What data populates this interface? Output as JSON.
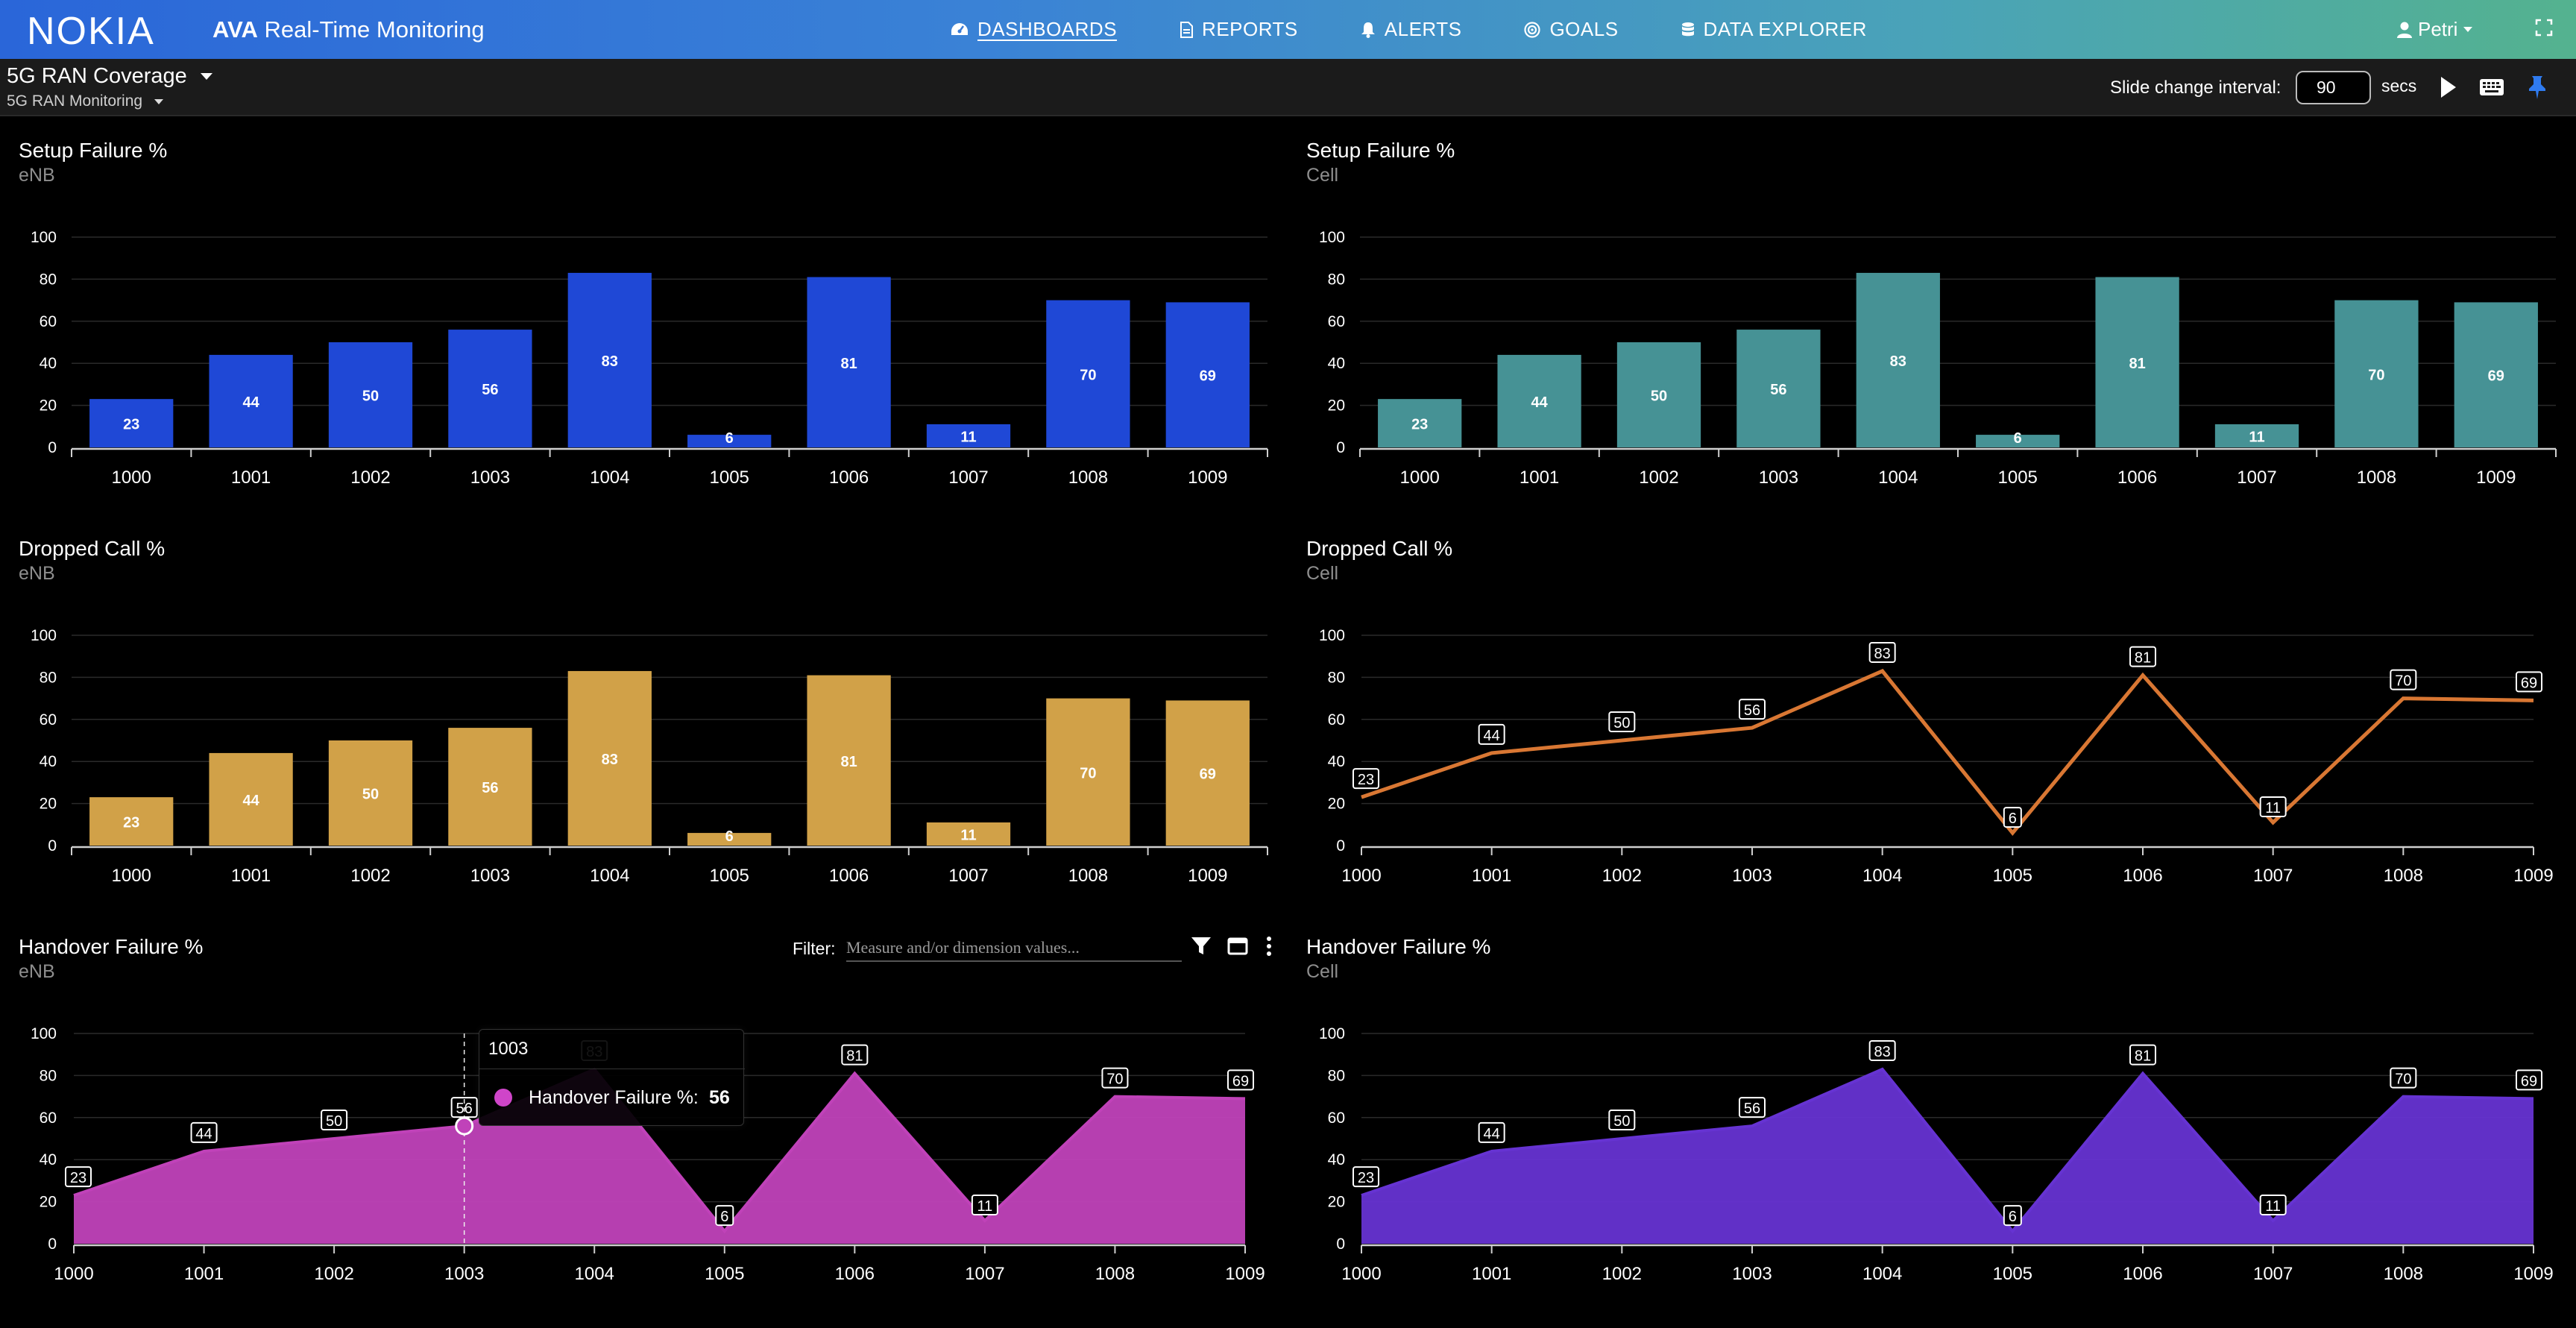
{
  "app": {
    "brand": "NOKIA",
    "title_bold": "AVA",
    "title_rest": " Real-Time Monitoring"
  },
  "nav": [
    {
      "label": "DASHBOARDS",
      "icon": "dashboard-icon",
      "active": true
    },
    {
      "label": "REPORTS",
      "icon": "report-icon",
      "active": false
    },
    {
      "label": "ALERTS",
      "icon": "bell-icon",
      "active": false
    },
    {
      "label": "GOALS",
      "icon": "target-icon",
      "active": false
    },
    {
      "label": "DATA EXPLORER",
      "icon": "database-icon",
      "active": false
    }
  ],
  "user": {
    "name": "Petri"
  },
  "dashboard": {
    "title": "5G RAN Coverage",
    "subtitle": "5G RAN Monitoring"
  },
  "slideshow": {
    "label": "Slide change interval:",
    "value": "90",
    "unit": "secs"
  },
  "filter": {
    "label": "Filter:",
    "placeholder": "Measure and/or dimension values..."
  },
  "tooltip": {
    "category": "1003",
    "series": "Handover Failure %:",
    "value": "56"
  },
  "colors": {
    "setup_enb": "#1f48d6",
    "setup_cell": "#469295",
    "dropped_enb": "#d1a148",
    "dropped_cell": "#d97733",
    "handover_enb": "#c042b9",
    "handover_cell": "#6633d2"
  },
  "chart_data": [
    {
      "id": "setup-enb",
      "type": "bar",
      "title": "Setup Failure %",
      "subtitle": "eNB",
      "categories": [
        "1000",
        "1001",
        "1002",
        "1003",
        "1004",
        "1005",
        "1006",
        "1007",
        "1008",
        "1009"
      ],
      "values": [
        23,
        44,
        50,
        56,
        83,
        6,
        81,
        11,
        70,
        69
      ],
      "ylim": [
        0,
        100
      ],
      "yticks": [
        0,
        20,
        40,
        60,
        80,
        100
      ],
      "grid": true,
      "color": "#1f48d6"
    },
    {
      "id": "setup-cell",
      "type": "bar",
      "title": "Setup Failure %",
      "subtitle": "Cell",
      "categories": [
        "1000",
        "1001",
        "1002",
        "1003",
        "1004",
        "1005",
        "1006",
        "1007",
        "1008",
        "1009"
      ],
      "values": [
        23,
        44,
        50,
        56,
        83,
        6,
        81,
        11,
        70,
        69
      ],
      "ylim": [
        0,
        100
      ],
      "yticks": [
        0,
        20,
        40,
        60,
        80,
        100
      ],
      "grid": true,
      "color": "#469295"
    },
    {
      "id": "dropped-enb",
      "type": "bar",
      "title": "Dropped Call %",
      "subtitle": "eNB",
      "categories": [
        "1000",
        "1001",
        "1002",
        "1003",
        "1004",
        "1005",
        "1006",
        "1007",
        "1008",
        "1009"
      ],
      "values": [
        23,
        44,
        50,
        56,
        83,
        6,
        81,
        11,
        70,
        69
      ],
      "ylim": [
        0,
        100
      ],
      "yticks": [
        0,
        20,
        40,
        60,
        80,
        100
      ],
      "grid": true,
      "color": "#d1a148"
    },
    {
      "id": "dropped-cell",
      "type": "line",
      "title": "Dropped Call %",
      "subtitle": "Cell",
      "categories": [
        "1000",
        "1001",
        "1002",
        "1003",
        "1004",
        "1005",
        "1006",
        "1007",
        "1008",
        "1009"
      ],
      "values": [
        23,
        44,
        50,
        56,
        83,
        6,
        81,
        11,
        70,
        69
      ],
      "ylim": [
        0,
        100
      ],
      "yticks": [
        0,
        20,
        40,
        60,
        80,
        100
      ],
      "grid": true,
      "color": "#d97733"
    },
    {
      "id": "handover-enb",
      "type": "area",
      "title": "Handover Failure %",
      "subtitle": "eNB",
      "categories": [
        "1000",
        "1001",
        "1002",
        "1003",
        "1004",
        "1005",
        "1006",
        "1007",
        "1008",
        "1009"
      ],
      "values": [
        23,
        44,
        50,
        56,
        83,
        6,
        81,
        11,
        70,
        69
      ],
      "ylim": [
        0,
        100
      ],
      "yticks": [
        0,
        20,
        40,
        60,
        80,
        100
      ],
      "grid": true,
      "color": "#c042b9",
      "hover_index": 3
    },
    {
      "id": "handover-cell",
      "type": "area",
      "title": "Handover Failure %",
      "subtitle": "Cell",
      "categories": [
        "1000",
        "1001",
        "1002",
        "1003",
        "1004",
        "1005",
        "1006",
        "1007",
        "1008",
        "1009"
      ],
      "values": [
        23,
        44,
        50,
        56,
        83,
        6,
        81,
        11,
        70,
        69
      ],
      "ylim": [
        0,
        100
      ],
      "yticks": [
        0,
        20,
        40,
        60,
        80,
        100
      ],
      "grid": true,
      "color": "#6633d2"
    }
  ]
}
